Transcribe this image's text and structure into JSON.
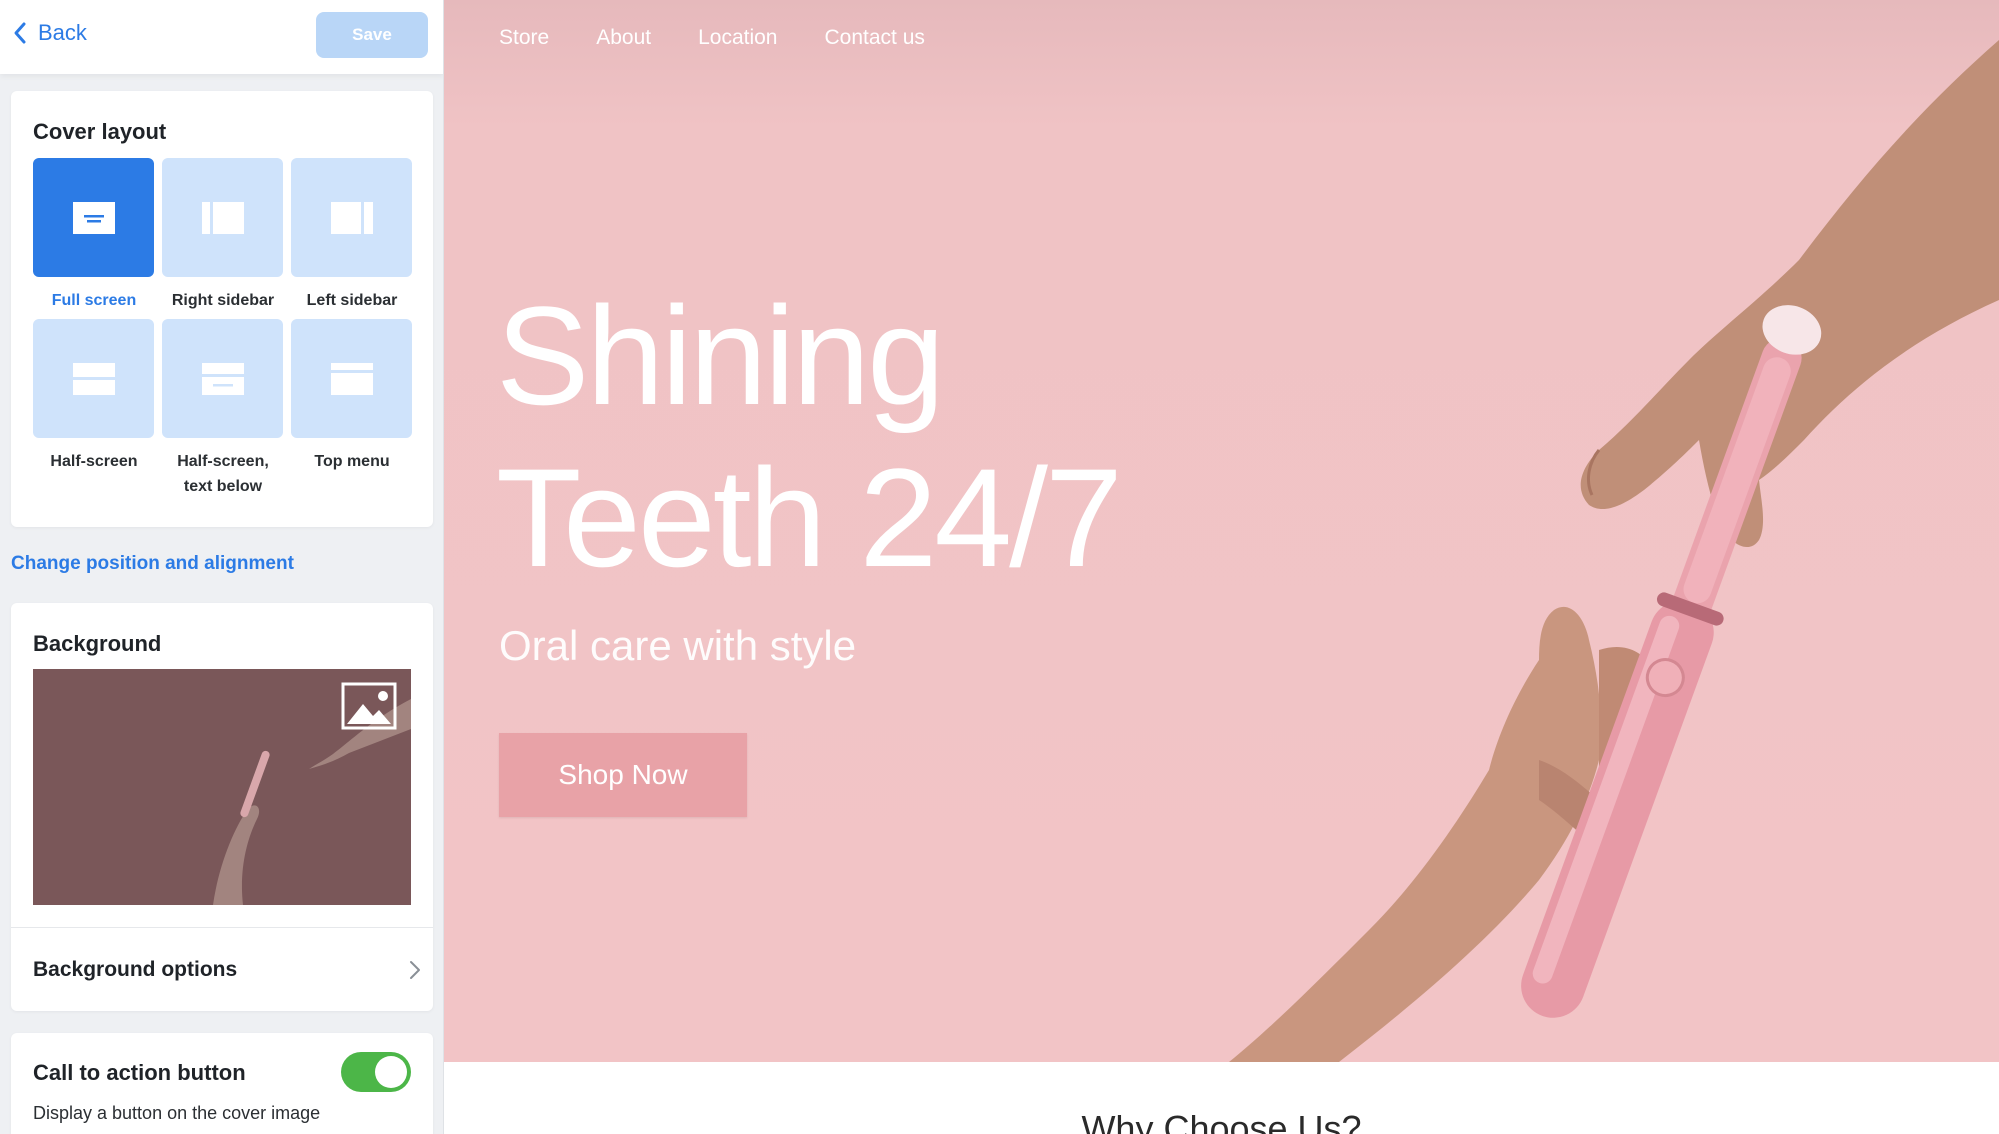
{
  "topbar": {
    "back_label": "Back",
    "save_label": "Save"
  },
  "cover_layout": {
    "title": "Cover layout",
    "options": [
      {
        "label": "Full screen",
        "selected": true
      },
      {
        "label": "Right sidebar",
        "selected": false
      },
      {
        "label": "Left sidebar",
        "selected": false
      },
      {
        "label": "Half-screen",
        "selected": false
      },
      {
        "label": "Half-screen, text below",
        "label_line1": "Half-screen,",
        "label_line2": "text below",
        "selected": false
      },
      {
        "label": "Top menu",
        "selected": false
      }
    ]
  },
  "change_position_link": "Change position and alignment",
  "background": {
    "title": "Background",
    "image_icon": "image-icon",
    "options_label": "Background options"
  },
  "cta": {
    "title": "Call to action button",
    "description": "Display a button on the cover image",
    "enabled": true
  },
  "preview": {
    "nav": [
      "Store",
      "About",
      "Location",
      "Contact us"
    ],
    "headline_line1": "Shining",
    "headline_line2": "Teeth 24/7",
    "subline": "Oral care with style",
    "button_label": "Shop Now",
    "next_section_title": "Why Choose Us?"
  },
  "colors": {
    "accent": "#2c7be5",
    "tile_inactive": "#cfe3fb",
    "hero_background": "#f2c4c6",
    "shop_button": "#e8a2a7",
    "toggle_on": "#4cb648"
  }
}
